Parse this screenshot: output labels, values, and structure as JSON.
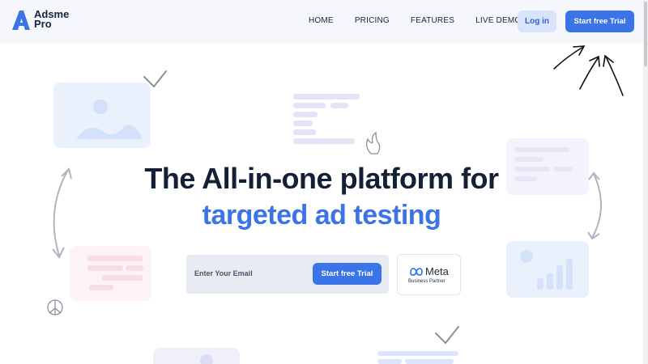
{
  "brand": {
    "line1": "Adsme",
    "line2": "Pro",
    "color": "#3b74e6"
  },
  "nav": {
    "items": [
      "HOME",
      "PRICING",
      "FEATURES",
      "LIVE DEMO"
    ],
    "login_label": "Log in",
    "trial_label": "Start free Trial"
  },
  "hero": {
    "headline_line1": "The All-in-one platform for",
    "headline_line2": "targeted ad testing",
    "email_placeholder": "Enter Your Email",
    "trial_label": "Start free Trial"
  },
  "partner": {
    "name": "Meta",
    "subtitle": "Business Partner"
  },
  "colors": {
    "accent": "#3b74e6",
    "dark": "#142036",
    "nav_bg": "#f5f7fc"
  },
  "icons": [
    "logo-a-icon",
    "meta-infinity-icon",
    "checkmark-icon",
    "arrow-icon",
    "flame-icon",
    "peace-icon"
  ]
}
